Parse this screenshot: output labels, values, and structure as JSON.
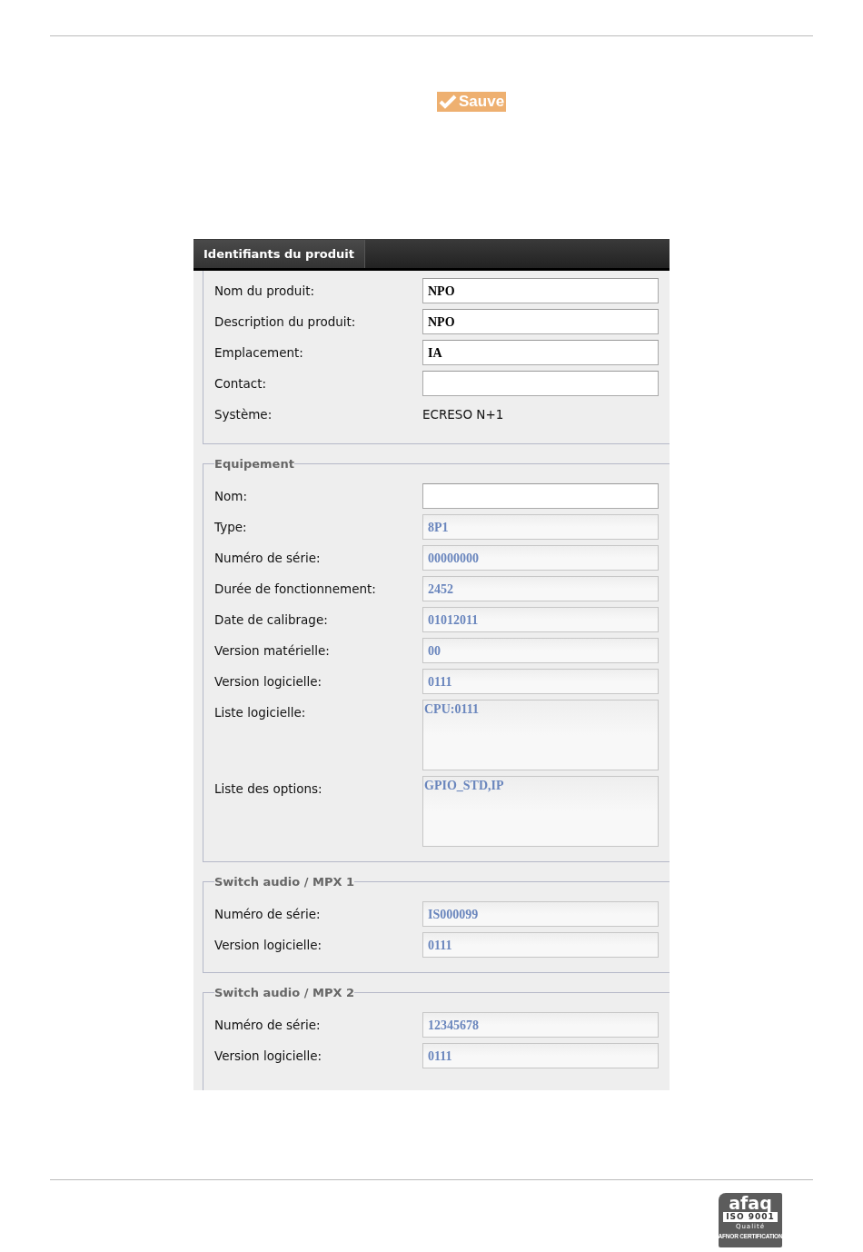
{
  "save_button": {
    "label": "Sauve"
  },
  "panel": {
    "tabs": [
      {
        "label": "Identifiants du produit",
        "selected": true
      }
    ],
    "sections": [
      {
        "fields": [
          {
            "label": "Nom du produit:",
            "kind": "input",
            "value": "NPO",
            "disabled": false
          },
          {
            "label": "Description du produit:",
            "kind": "input",
            "value": "NPO",
            "disabled": false
          },
          {
            "label": "Emplacement:",
            "kind": "input",
            "value": "IA",
            "disabled": false
          },
          {
            "label": "Contact:",
            "kind": "input",
            "disabled": false
          },
          {
            "label": "Système:",
            "kind": "static",
            "value": "ECRESO N+1"
          }
        ]
      },
      {
        "legend": "Equipement",
        "fields": [
          {
            "label": "Nom:",
            "kind": "input",
            "disabled": false
          },
          {
            "label": "Type:",
            "kind": "input",
            "value": "8P1",
            "disabled": true
          },
          {
            "label": "Numéro de série:",
            "kind": "input",
            "value": "00000000",
            "disabled": true
          },
          {
            "label": "Durée de fonctionnement:",
            "kind": "input",
            "value": "2452",
            "disabled": true
          },
          {
            "label": "Date de calibrage:",
            "kind": "input",
            "value": "01012011",
            "disabled": true
          },
          {
            "label": "Version matérielle:",
            "kind": "input",
            "value": "00",
            "disabled": true
          },
          {
            "label": "Version logicielle:",
            "kind": "input",
            "value": "0111",
            "disabled": true
          },
          {
            "label": "Liste logicielle:",
            "kind": "textarea",
            "value": "CPU:0111",
            "disabled": true
          },
          {
            "label": "Liste des options:",
            "kind": "textarea",
            "value": "GPIO_STD,IP",
            "disabled": true
          }
        ]
      },
      {
        "legend": "Switch audio / MPX 1",
        "fields": [
          {
            "label": "Numéro de série:",
            "kind": "input",
            "value": "IS000099",
            "disabled": true
          },
          {
            "label": "Version logicielle:",
            "kind": "input",
            "value": "0111",
            "disabled": true
          }
        ]
      },
      {
        "legend": "Switch audio / MPX 2",
        "fields": [
          {
            "label": "Numéro de série:",
            "kind": "input",
            "value": "12345678",
            "disabled": true
          },
          {
            "label": "Version logicielle:",
            "kind": "input",
            "value": "0111",
            "disabled": true
          }
        ]
      }
    ]
  },
  "logo": {
    "wordmark": "afaq",
    "standard": "ISO 9001",
    "grade": "Qualité",
    "certifier": "AFNOR CERTIFICATION"
  }
}
